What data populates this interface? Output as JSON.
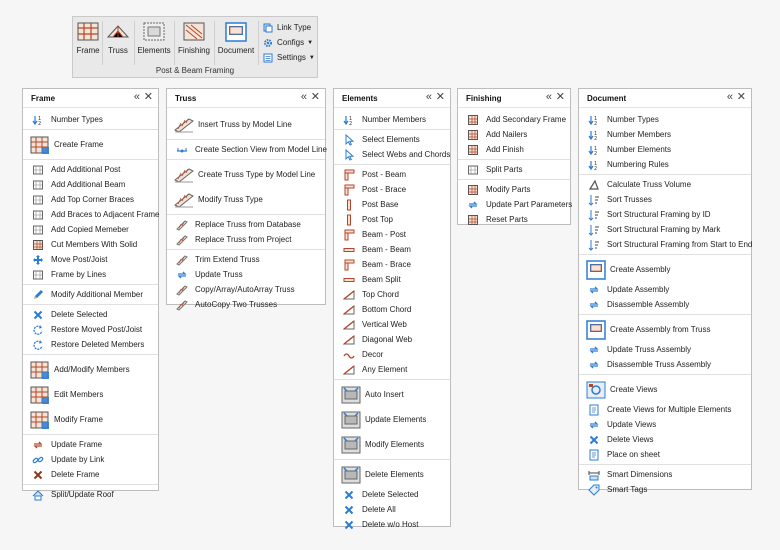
{
  "ribbon": {
    "group_label": "Post & Beam Framing",
    "frame": "Frame",
    "truss": "Truss",
    "elements": "Elements",
    "finishing": "Finishing",
    "document": "Document",
    "link_type": "Link Type",
    "configs": "Configs",
    "settings": "Settings"
  },
  "frame_panel": {
    "title": "Frame",
    "items": [
      "Number Types",
      "Create Frame",
      "Add Additional Post",
      "Add Additional Beam",
      "Add Top Corner Braces",
      "Add Braces to Adjacent Frame",
      "Add Copied Memeber",
      "Cut Members With Solid",
      "Move Post/Joist",
      "Frame by Lines",
      "Modify Additional Member",
      "Delete Selected",
      "Restore Moved Post/Joist",
      "Restore Deleted Members",
      "Add/Modify Members",
      "Edit Members",
      "Modify Frame",
      "Update Frame",
      "Update by Link",
      "Delete Frame",
      "Split/Update Roof"
    ]
  },
  "truss_panel": {
    "title": "Truss",
    "items": [
      "Insert Truss by Model Line",
      "Create Section View from Model Line",
      "Create Truss Type by Model Line",
      "Modify Truss Type",
      "Replace Truss from Database",
      "Replace Truss from Project",
      "Trim Extend Truss",
      "Update Truss",
      "Copy/Array/AutoArray Truss",
      "AutoCopy Two Trusses"
    ]
  },
  "elements_panel": {
    "title": "Elements",
    "items": [
      "Number Members",
      "Select Elements",
      "Select Webs and Chords",
      "Post - Beam",
      "Post - Brace",
      "Post Base",
      "Post Top",
      "Beam - Post",
      "Beam - Beam",
      "Beam - Brace",
      "Beam Split",
      "Top Chord",
      "Bottom Chord",
      "Vertical Web",
      "Diagonal Web",
      "Decor",
      "Any Element",
      "Auto Insert",
      "Update Elements",
      "Modify Elements",
      "Delete Elements",
      "Delete Selected",
      "Delete All",
      "Delete w/o Host"
    ]
  },
  "finishing_panel": {
    "title": "Finishing",
    "items": [
      "Add Secondary Frame",
      "Add Nailers",
      "Add Finish",
      "Split Parts",
      "Modify Parts",
      "Update Part Parameters",
      "Reset Parts"
    ]
  },
  "document_panel": {
    "title": "Document",
    "items": [
      "Number Types",
      "Number Members",
      "Number Elements",
      "Numbering Rules",
      "Calculate Truss Volume",
      "Sort Trusses",
      "Sort Structural Framing by ID",
      "Sort Structural Framing by Mark",
      "Sort Structural Framing from Start to End",
      "Create Assembly",
      "Update Assembly",
      "Disassemble Assembly",
      "Create Assembly from Truss",
      "Update Truss Assembly",
      "Disassemble Truss Assembly",
      "Create Views",
      "Create Views for Multiple Elements",
      "Update Views",
      "Delete Views",
      "Place on sheet",
      "Smart Dimensions",
      "Smart Tags"
    ]
  },
  "controls": {
    "collapse": "«",
    "close": "✕"
  },
  "colors": {
    "accent_blue": "#2b7cd3",
    "accent_red": "#b5462a",
    "frame_gray": "#707070"
  }
}
